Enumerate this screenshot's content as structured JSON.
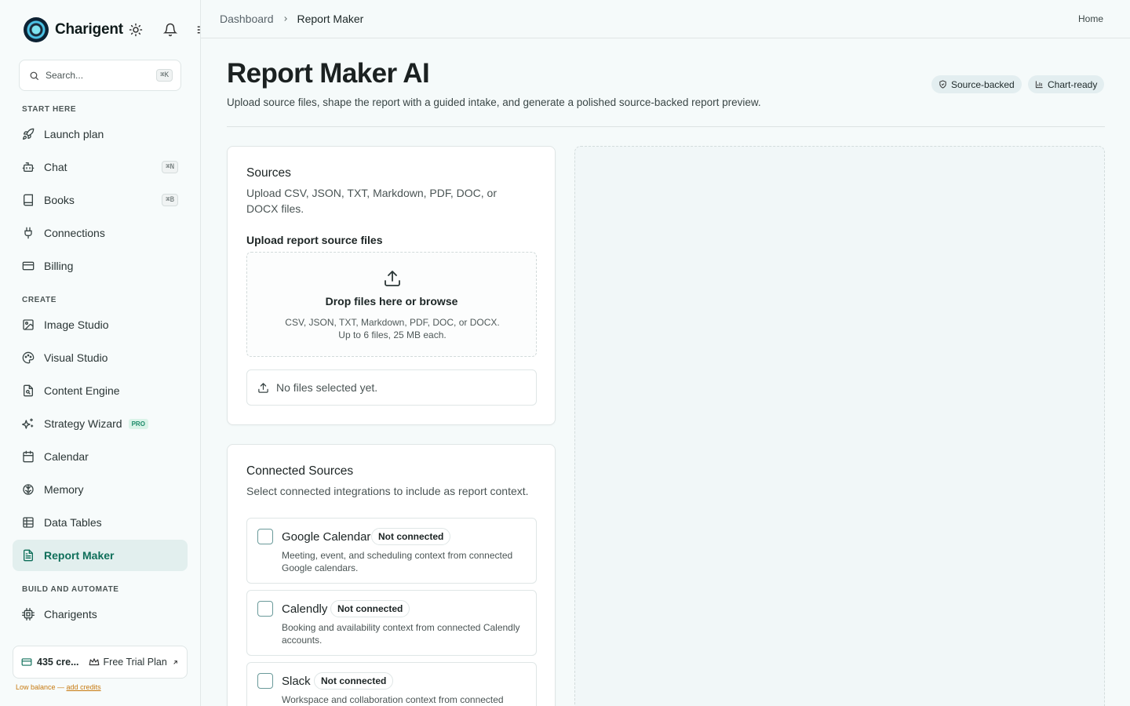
{
  "app": {
    "name": "Charigent"
  },
  "sidebar": {
    "search": {
      "placeholder": "Search...",
      "shortcut": "⌘K"
    },
    "sections": [
      {
        "label": "START HERE"
      },
      {
        "label": "CREATE"
      },
      {
        "label": "BUILD AND AUTOMATE"
      }
    ],
    "items": [
      {
        "label": "Launch plan",
        "icon": "rocket-icon"
      },
      {
        "label": "Chat",
        "icon": "bot-icon",
        "shortcut": "⌘N"
      },
      {
        "label": "Books",
        "icon": "book-icon",
        "shortcut": "⌘B"
      },
      {
        "label": "Connections",
        "icon": "plug-icon"
      },
      {
        "label": "Billing",
        "icon": "credit-card-icon"
      },
      {
        "label": "Image Studio",
        "icon": "image-icon"
      },
      {
        "label": "Visual Studio",
        "icon": "palette-icon"
      },
      {
        "label": "Content Engine",
        "icon": "file-icon"
      },
      {
        "label": "Strategy Wizard",
        "icon": "sparkles-icon",
        "badge": "PRO"
      },
      {
        "label": "Calendar",
        "icon": "calendar-icon"
      },
      {
        "label": "Memory",
        "icon": "brain-icon"
      },
      {
        "label": "Data Tables",
        "icon": "table-icon"
      },
      {
        "label": "Report Maker",
        "icon": "report-icon",
        "active": true
      },
      {
        "label": "Charigents",
        "icon": "cpu-icon"
      }
    ],
    "credits": {
      "amount": "435 cre...",
      "plan": "Free Trial Plan"
    },
    "low_balance": {
      "text": "Low balance — ",
      "link": "add credits"
    }
  },
  "topbar": {
    "breadcrumb": [
      "Dashboard",
      "Report Maker"
    ],
    "home": "Home"
  },
  "page": {
    "title": "Report Maker AI",
    "subtitle": "Upload source files, shape the report with a guided intake, and generate a polished source-backed report preview.",
    "badges": [
      "Source-backed",
      "Chart-ready"
    ]
  },
  "sources_card": {
    "title": "Sources",
    "description": "Upload CSV, JSON, TXT, Markdown, PDF, DOC, or DOCX files.",
    "upload_label": "Upload report source files",
    "dropzone_title": "Drop files here or browse",
    "dropzone_hint": "CSV, JSON, TXT, Markdown, PDF, DOC, or DOCX. Up to 6 files, 25 MB each.",
    "file_status": "No files selected yet."
  },
  "connected_card": {
    "title": "Connected Sources",
    "description": "Select connected integrations to include as report context.",
    "items": [
      {
        "name": "Google Calendar",
        "status": "Not connected",
        "description": "Meeting, event, and scheduling context from connected Google calendars."
      },
      {
        "name": "Calendly",
        "status": "Not connected",
        "description": "Booking and availability context from connected Calendly accounts."
      },
      {
        "name": "Slack",
        "status": "Not connected",
        "description": "Workspace and collaboration context from connected"
      }
    ]
  },
  "colors": {
    "accent": "#0f6f5a",
    "warning": "#c77a10",
    "background": "#f5fafa"
  }
}
